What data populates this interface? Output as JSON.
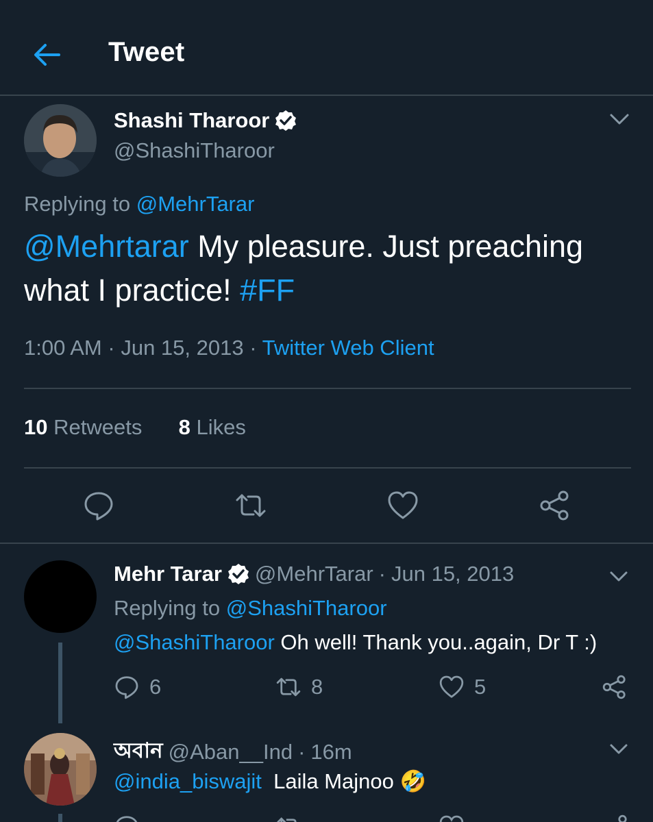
{
  "header": {
    "title": "Tweet",
    "back_icon": "arrow-left-icon"
  },
  "colors": {
    "background": "#15202b",
    "accent": "#1da1f2",
    "muted": "#8899a6",
    "divider": "#38444d"
  },
  "main_tweet": {
    "name": "Shashi Tharoor",
    "handle": "@ShashiTharoor",
    "replying_prefix": "Replying to",
    "replying_to": "@MehrTarar",
    "text_mention": "@Mehrtarar",
    "text_body": " My pleasure. Just preaching what I practice! ",
    "text_hashtag": "#FF",
    "time": "1:00 AM",
    "dot": "·",
    "date": "Jun 15, 2013",
    "source": "Twitter Web Client",
    "retweets_count": "10",
    "retweets_label": "Retweets",
    "likes_count": "8",
    "likes_label": "Likes"
  },
  "replies": [
    {
      "name": "Mehr Tarar",
      "handle": "@MehrTarar",
      "dot": "·",
      "date": "Jun 15, 2013",
      "replying_prefix": "Replying to",
      "replying_to": "@ShashiTharoor",
      "text_mention": "@ShashiTharoor",
      "text_body": " Oh well! Thank you..again, Dr T :)",
      "replies_count": "6",
      "retweets_count": "8",
      "likes_count": "5"
    },
    {
      "name": "অবান",
      "handle": "@Aban__Ind",
      "dot": "·",
      "date": "16m",
      "text_mention": "@india_biswajit",
      "text_body": "  Laila Majnoo ",
      "emoji": "🤣"
    }
  ]
}
